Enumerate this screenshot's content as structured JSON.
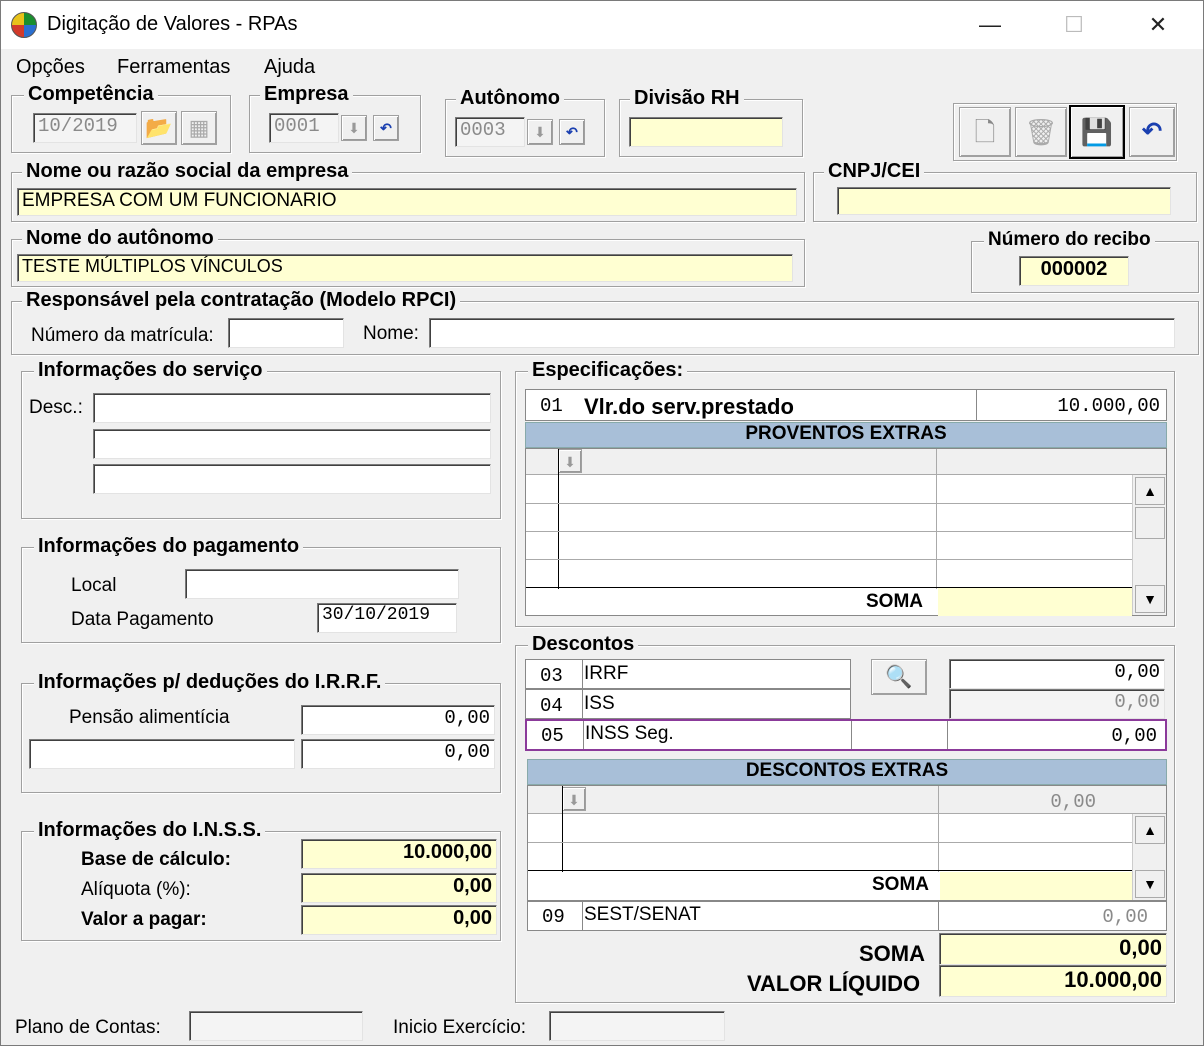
{
  "window": {
    "title": "Digitação de Valores - RPAs",
    "minimize": "—",
    "maximize": "☐",
    "close": "✕"
  },
  "menu": [
    "Opções",
    "Ferramentas",
    "Ajuda"
  ],
  "competencia": {
    "label": "Competência",
    "value": "10/2019"
  },
  "empresa": {
    "label": "Empresa",
    "value": "0001"
  },
  "autonomo": {
    "label": "Autônomo",
    "value": "0003"
  },
  "divisao": {
    "label": "Divisão RH",
    "value": ""
  },
  "razao": {
    "label": "Nome ou razão social da empresa",
    "value": "EMPRESA COM UM FUNCIONARIO"
  },
  "cnpj": {
    "label": "CNPJ/CEI",
    "value": ""
  },
  "nome_autonomo": {
    "label": "Nome do autônomo",
    "value": "TESTE MÚLTIPLOS VÍNCULOS"
  },
  "recibo": {
    "label": "Número do recibo",
    "value": "000002"
  },
  "responsavel": {
    "label": "Responsável pela contratação (Modelo RPCI)",
    "matricula_label": "Número da matrícula:",
    "nome_label": "Nome:",
    "matricula": "",
    "nome": ""
  },
  "servico": {
    "label": "Informações do serviço",
    "desc_label": "Desc.:"
  },
  "pagamento": {
    "label": "Informações do pagamento",
    "local_label": "Local",
    "local": "",
    "data_label": "Data Pagamento",
    "data": "30/10/2019"
  },
  "irrf": {
    "label": "Informações p/ deduções do I.R.R.F.",
    "pensao_label": "Pensão alimentícia",
    "pensao": "0,00",
    "outro": "0,00"
  },
  "inss": {
    "label": "Informações do I.N.S.S.",
    "base_label": "Base de cálculo:",
    "base": "10.000,00",
    "aliquota_label": "Alíquota (%):",
    "aliquota": "0,00",
    "valor_label": "Valor a pagar:",
    "valor": "0,00"
  },
  "especificacoes": {
    "label": "Especificações:",
    "code": "01",
    "desc": "Vlr.do serv.prestado",
    "value": "10.000,00",
    "extras_header": "PROVENTOS EXTRAS",
    "soma_label": "SOMA"
  },
  "descontos": {
    "label": "Descontos",
    "rows": [
      {
        "code": "03",
        "desc": "IRRF",
        "value": "0,00"
      },
      {
        "code": "04",
        "desc": "ISS",
        "value": "0,00"
      },
      {
        "code": "05",
        "desc": "INSS Seg.",
        "value": "0,00"
      }
    ],
    "extras_header": "DESCONTOS EXTRAS",
    "extras_value": "0,00",
    "soma_label": "SOMA",
    "sest_code": "09",
    "sest_desc": "SEST/SENAT",
    "sest_value": "0,00"
  },
  "totais": {
    "soma_label": "SOMA",
    "soma": "0,00",
    "liquido_label": "VALOR LÍQUIDO",
    "liquido": "10.000,00"
  },
  "status": {
    "plano_label": "Plano de Contas:",
    "plano": "",
    "inicio_label": "Inicio Exercício:",
    "inicio": ""
  },
  "colors": {
    "input_yellow": "#ffffd2",
    "header_blue": "#a8bfd8",
    "highlight_purple": "#8b3a9a"
  }
}
